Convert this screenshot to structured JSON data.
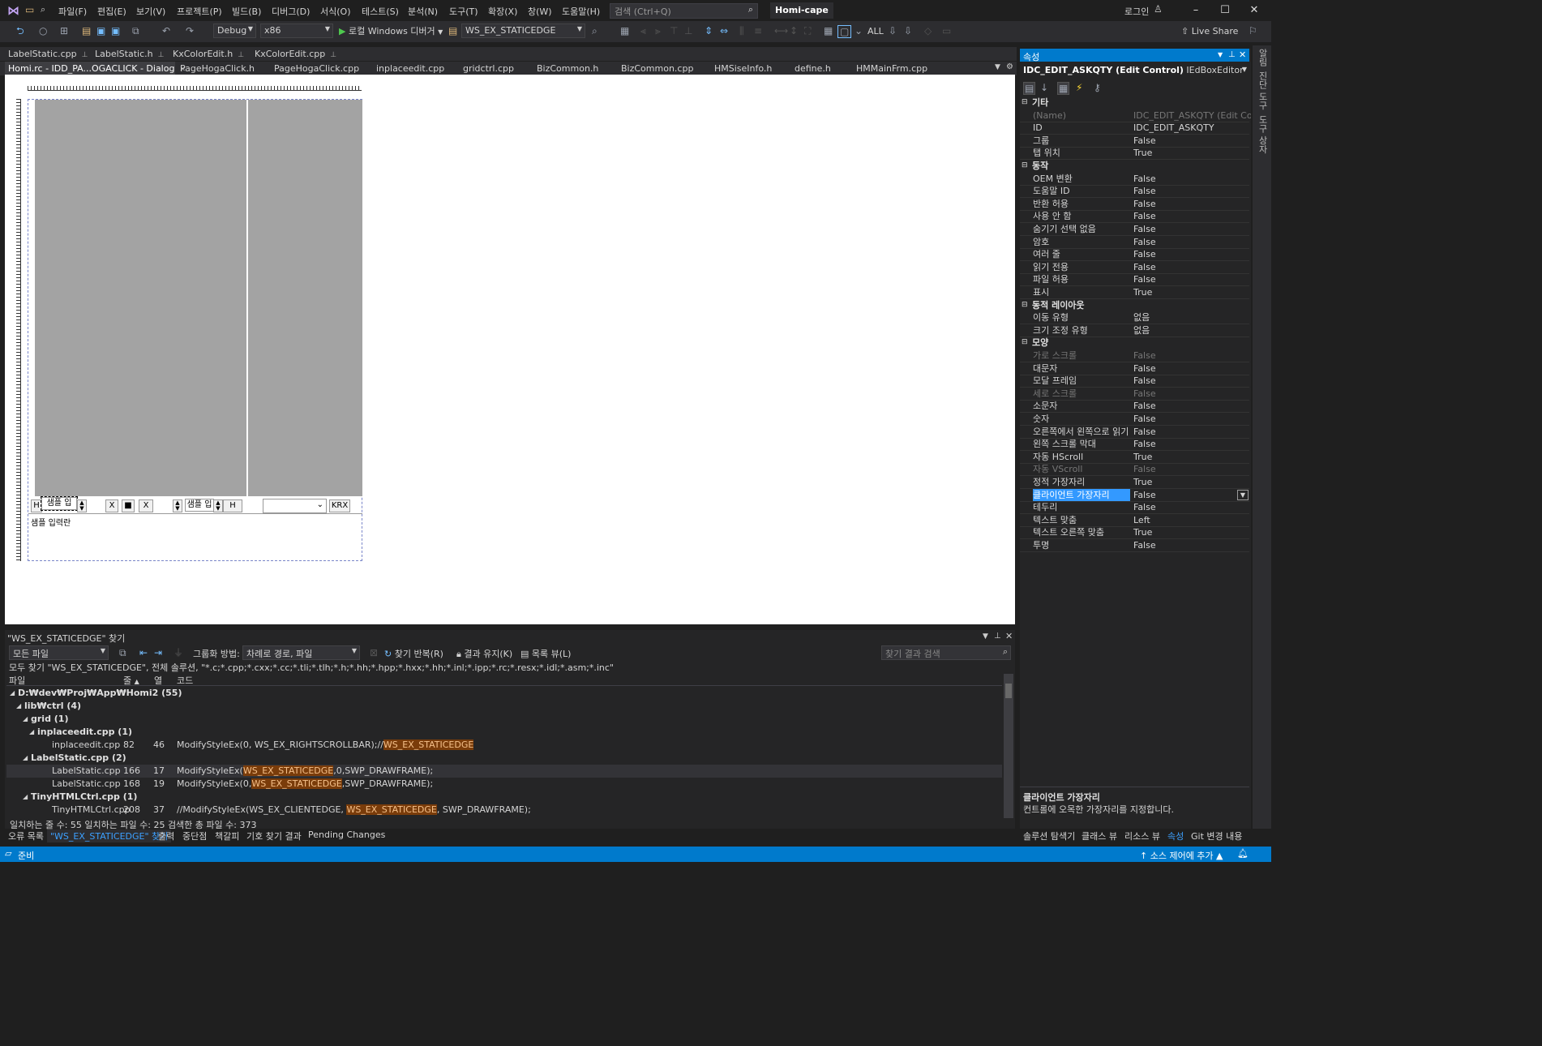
{
  "titlebar": {
    "menus": [
      "파일(F)",
      "편집(E)",
      "보기(V)",
      "프로젝트(P)",
      "빌드(B)",
      "디버그(D)",
      "서식(O)",
      "테스트(S)",
      "분석(N)",
      "도구(T)",
      "확장(X)",
      "창(W)",
      "도움말(H)"
    ],
    "search_placeholder": "검색 (Ctrl+Q)",
    "solution_name": "Homi-cape",
    "login": "로그인"
  },
  "toolbar": {
    "config": "Debug",
    "platform": "x86",
    "run_label": "로컬 Windows 디버거",
    "find_combo": "WS_EX_STATICEDGE",
    "all_label": "ALL",
    "live_share": "Live Share"
  },
  "tabs_row1": [
    {
      "label": "LabelStatic.cpp"
    },
    {
      "label": "LabelStatic.h"
    },
    {
      "label": "KxColorEdit.h"
    },
    {
      "label": "KxColorEdit.cpp"
    }
  ],
  "tabs_row2": [
    {
      "label": "Homi.rc - IDD_PA...OGACLICK - Dialog"
    },
    {
      "label": "PageHogaClick.h"
    },
    {
      "label": "PageHogaClick.cpp"
    },
    {
      "label": "inplaceedit.cpp"
    },
    {
      "label": "gridctrl.cpp"
    },
    {
      "label": "BizCommon.h"
    },
    {
      "label": "BizCommon.cpp"
    },
    {
      "label": "HMSiseInfo.h"
    },
    {
      "label": "define.h"
    },
    {
      "label": "HMMainFrm.cpp"
    }
  ],
  "dialog": {
    "edit_sample": "샘플 입",
    "edit_sample2": "샘플 입",
    "label_input": "샘플 입력란",
    "btn_h": "H",
    "btn_x": "X",
    "btn_stop": "■",
    "btn_x2": "X",
    "btn_h2": "H",
    "btn_krx": "KRX"
  },
  "find_panel": {
    "title": "\"WS_EX_STATICEDGE\" 찾기",
    "scope": "모든 파일",
    "group_label": "그룹화 방법:",
    "group_value": "차례로 경로, 파일",
    "repeat_find": "찾기 반복(R)",
    "keep_results": "결과 유지(K)",
    "list_view": "목록 뷰(L)",
    "search_results_placeholder": "찾기 결과 검색",
    "summary": "모두 찾기 \"WS_EX_STATICEDGE\", 전체 솔루션, \"*.c;*.cpp;*.cxx;*.cc;*.tli;*.tlh;*.h;*.hh;*.hpp;*.hxx;*.hh;*.inl;*.ipp;*.rc;*.resx;*.idl;*.asm;*.inc\"",
    "columns": [
      "파일",
      "줄",
      "열",
      "코드"
    ],
    "footer": "일치하는 줄 수: 55 일치하는 파일 수: 25 검색한 총 파일 수: 373",
    "rows": [
      {
        "indent": 0,
        "label": "D:₩dev₩Proj₩App₩Homi2 (55)",
        "group": true
      },
      {
        "indent": 1,
        "label": "lib₩ctrl (4)",
        "group": true
      },
      {
        "indent": 2,
        "label": "grid (1)",
        "group": true
      },
      {
        "indent": 3,
        "label": "inplaceedit.cpp (1)",
        "group": true
      },
      {
        "indent": 4,
        "file": "inplaceedit.cpp",
        "line": "82",
        "col": "46",
        "pre": "ModifyStyleEx(0, WS_EX_RIGHTSCROLLBAR);//",
        "match": "WS_EX_STATICEDGE",
        "post": ""
      },
      {
        "indent": 2,
        "label": "LabelStatic.cpp (2)",
        "group": true
      },
      {
        "indent": 4,
        "file": "LabelStatic.cpp",
        "line": "166",
        "col": "17",
        "pre": "ModifyStyleEx(",
        "match": "WS_EX_STATICEDGE",
        "post": ",0,SWP_DRAWFRAME);"
      },
      {
        "indent": 4,
        "file": "LabelStatic.cpp",
        "line": "168",
        "col": "19",
        "pre": "ModifyStyleEx(0,",
        "match": "WS_EX_STATICEDGE",
        "post": ",SWP_DRAWFRAME);"
      },
      {
        "indent": 2,
        "label": "TinyHTMLCtrl.cpp (1)",
        "group": true
      },
      {
        "indent": 4,
        "file": "TinyHTMLCtrl.cpp",
        "line": "208",
        "col": "37",
        "pre": "//ModifyStyleEx(WS_EX_CLIENTEDGE, ",
        "match": "WS_EX_STATICEDGE",
        "post": ", SWP_DRAWFRAME);"
      }
    ]
  },
  "bottom_tabs": [
    "오류 목록",
    "\"WS_EX_STATICEDGE\" 찾기",
    "출력",
    "중단점",
    "책갈피",
    "기호 찾기 결과",
    "Pending Changes"
  ],
  "properties": {
    "title": "속성",
    "object": "IDC_EDIT_ASKQTY (Edit Control)",
    "object_type": "IEdBoxEditor",
    "categories": [
      {
        "name": "기타",
        "props": [
          {
            "name": "(Name)",
            "value": "IDC_EDIT_ASKQTY (Edit Control)",
            "dim": true
          },
          {
            "name": "ID",
            "value": "IDC_EDIT_ASKQTY"
          },
          {
            "name": "그룹",
            "value": "False"
          },
          {
            "name": "탭 위치",
            "value": "True"
          }
        ]
      },
      {
        "name": "동작",
        "props": [
          {
            "name": "OEM 변환",
            "value": "False"
          },
          {
            "name": "도움말 ID",
            "value": "False"
          },
          {
            "name": "반환 허용",
            "value": "False"
          },
          {
            "name": "사용 안 함",
            "value": "False"
          },
          {
            "name": "숨기기 선택 없음",
            "value": "False"
          },
          {
            "name": "암호",
            "value": "False"
          },
          {
            "name": "여러 줄",
            "value": "False"
          },
          {
            "name": "읽기 전용",
            "value": "False"
          },
          {
            "name": "파일 허용",
            "value": "False"
          },
          {
            "name": "표시",
            "value": "True"
          }
        ]
      },
      {
        "name": "동적 레이아웃",
        "props": [
          {
            "name": "이동 유형",
            "value": "없음"
          },
          {
            "name": "크기 조정 유형",
            "value": "없음"
          }
        ]
      },
      {
        "name": "모양",
        "props": [
          {
            "name": "가로 스크롤",
            "value": "False",
            "dim": true
          },
          {
            "name": "대문자",
            "value": "False"
          },
          {
            "name": "모달 프레임",
            "value": "False"
          },
          {
            "name": "세로 스크롤",
            "value": "False",
            "dim": true
          },
          {
            "name": "소문자",
            "value": "False"
          },
          {
            "name": "숫자",
            "value": "False"
          },
          {
            "name": "오른쪽에서 왼쪽으로 읽기",
            "value": "False"
          },
          {
            "name": "왼쪽 스크롤 막대",
            "value": "False"
          },
          {
            "name": "자동 HScroll",
            "value": "True"
          },
          {
            "name": "자동 VScroll",
            "value": "False",
            "dim": true
          },
          {
            "name": "정적 가장자리",
            "value": "True"
          },
          {
            "name": "클라이언트 가장자리",
            "value": "False",
            "selected": true
          },
          {
            "name": "테두리",
            "value": "False"
          },
          {
            "name": "텍스트 맞춤",
            "value": "Left"
          },
          {
            "name": "텍스트 오른쪽 맞춤",
            "value": "True"
          },
          {
            "name": "투명",
            "value": "False"
          }
        ]
      }
    ],
    "desc_title": "클라이언트 가장자리",
    "desc_text": "컨트롤에 오목한 가장자리를 지정합니다."
  },
  "right_bottom_tabs": [
    "솔루션 탐색기",
    "클래스 뷰",
    "리소스 뷰",
    "속성",
    "Git 변경 내용"
  ],
  "side_tabs": [
    "알림",
    "진단 도구",
    "도구 상자"
  ],
  "statusbar": {
    "ready": "준비",
    "source_control": "소스 제어에 추가"
  },
  "colors": {
    "accent": "#007acc",
    "highlight": "#7a3c0a",
    "selected_prop": "#3399ff"
  }
}
